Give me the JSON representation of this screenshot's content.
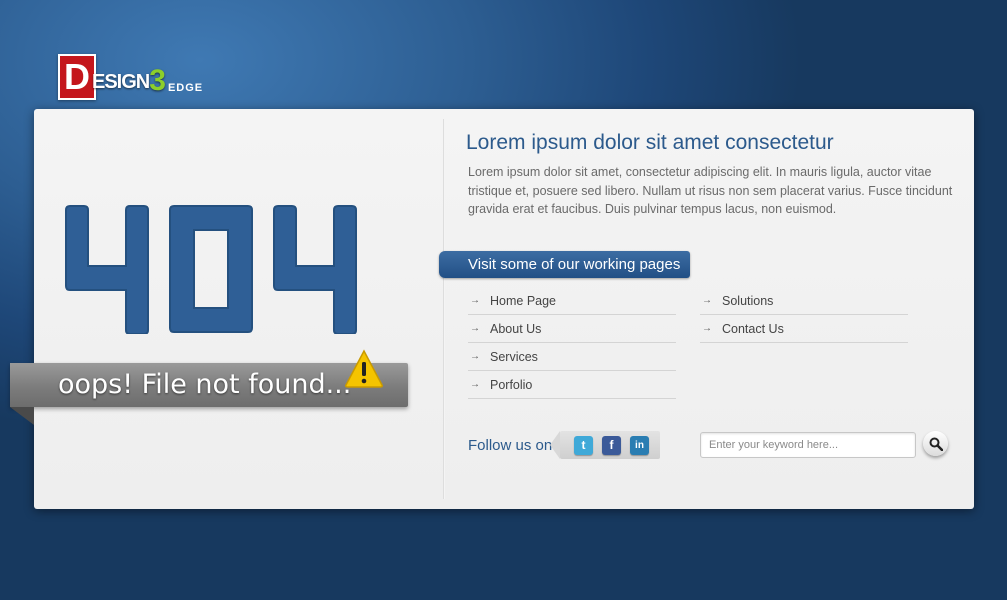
{
  "logo": {
    "letter": "D",
    "word": "ESIGN",
    "number": "3",
    "suffix": "EDGE"
  },
  "error": {
    "code_digits": [
      "4",
      "0",
      "4"
    ],
    "message": "oops! File not found...",
    "warning_icon": "warning-triangle-icon"
  },
  "content": {
    "heading": "Lorem ipsum dolor sit amet consectetur",
    "intro": "Lorem ipsum dolor sit amet, consectetur adipiscing elit. In mauris ligula, auctor vitae tristique et, posuere sed libero. Nullam ut risus non sem placerat varius. Fusce tincidunt gravida erat et faucibus. Duis pulvinar tempus lacus, non euismod.",
    "pages_tab": "Visit some of our working pages"
  },
  "links": {
    "col1": [
      {
        "label": "Home Page"
      },
      {
        "label": "About Us"
      },
      {
        "label": "Services"
      },
      {
        "label": "Porfolio"
      }
    ],
    "col2": [
      {
        "label": "Solutions"
      },
      {
        "label": "Contact Us"
      }
    ]
  },
  "social": {
    "follow_label": "Follow us on",
    "icons": [
      "twitter-icon",
      "facebook-icon",
      "linkedin-icon"
    ],
    "twitter_glyph": "t",
    "facebook_glyph": "f",
    "linkedin_glyph": "in"
  },
  "search": {
    "placeholder": "Enter your keyword here...",
    "value": ""
  },
  "colors": {
    "background": "#2d5e92",
    "accent": "#2c5a8c",
    "logo_red": "#c4161c",
    "logo_green": "#8ccf2b",
    "warning_yellow": "#f5c400"
  }
}
